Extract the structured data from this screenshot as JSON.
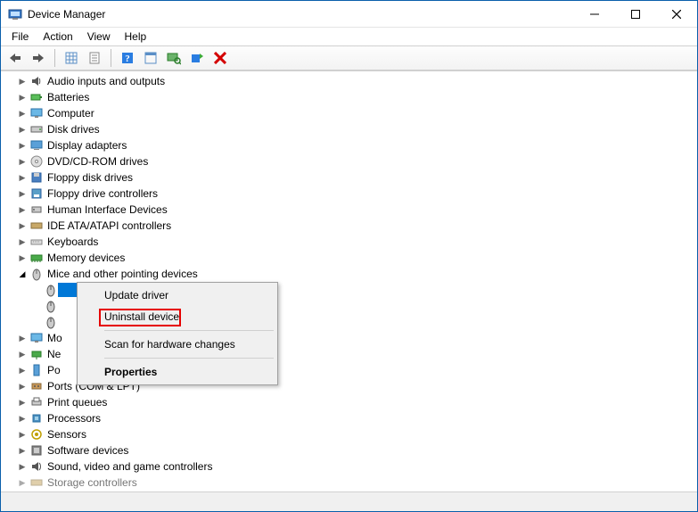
{
  "window": {
    "title": "Device Manager"
  },
  "menubar": [
    "File",
    "Action",
    "View",
    "Help"
  ],
  "context_menu": {
    "update": "Update driver",
    "uninstall": "Uninstall device",
    "scan": "Scan for hardware changes",
    "properties": "Properties"
  },
  "tree": {
    "audio": "Audio inputs and outputs",
    "batteries": "Batteries",
    "computer": "Computer",
    "disk": "Disk drives",
    "display": "Display adapters",
    "dvd": "DVD/CD-ROM drives",
    "floppy_disk": "Floppy disk drives",
    "floppy_ctrl": "Floppy drive controllers",
    "hid": "Human Interface Devices",
    "ide": "IDE ATA/ATAPI controllers",
    "keyboards": "Keyboards",
    "memory": "Memory devices",
    "mice": "Mice and other pointing devices",
    "mouse_child_1": "",
    "mouse_child_2": "",
    "mouse_child_3": "",
    "mo": "Mo",
    "ne": "Ne",
    "po": "Po",
    "ports": "Ports (COM & LPT)",
    "print": "Print queues",
    "processors": "Processors",
    "sensors": "Sensors",
    "software": "Software devices",
    "sound": "Sound, video and game controllers",
    "storage": "Storage controllers"
  },
  "icons": {
    "back": "back-icon",
    "forward": "forward-icon",
    "show_hidden": "show-hidden-icon",
    "properties": "properties-icon",
    "help": "help-icon",
    "options": "options-icon",
    "update": "update-driver-icon",
    "scan": "scan-hardware-icon",
    "uninstall": "uninstall-icon"
  }
}
